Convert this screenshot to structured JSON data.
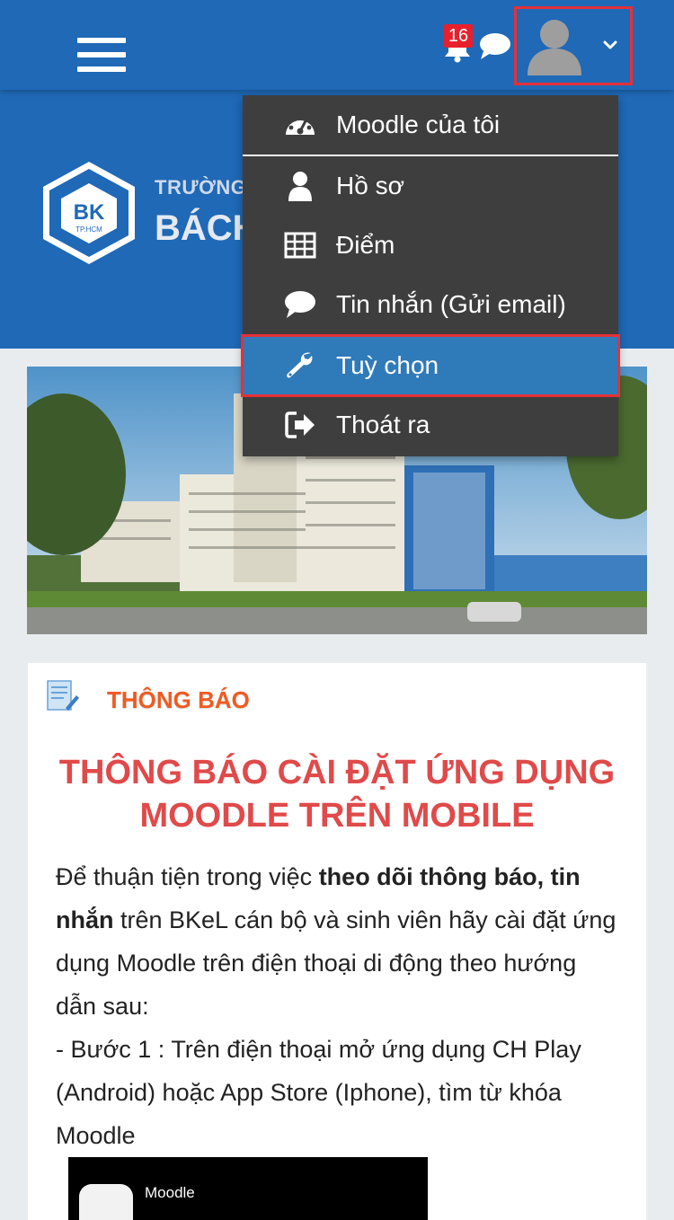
{
  "navbar": {
    "notification_count": "16",
    "icons": {
      "menu": "hamburger-menu-icon",
      "notifications": "bell-icon",
      "messages": "chat-bubble-icon",
      "user": "user-avatar-icon",
      "dropdown": "chevron-down-icon"
    }
  },
  "header": {
    "school_line1": "TRƯỜNG Đ",
    "school_line2": "BÁCH",
    "logo_text": "BK",
    "logo_subtext": "TP.HCM"
  },
  "user_menu": {
    "items": [
      {
        "label": "Moodle của tôi",
        "icon": "dashboard-gauge-icon"
      },
      {
        "label": "Hồ sơ",
        "icon": "user-icon"
      },
      {
        "label": "Điểm",
        "icon": "grid-table-icon"
      },
      {
        "label": "Tin nhắn (Gửi email)",
        "icon": "chat-bubble-icon"
      },
      {
        "label": "Tuỳ chọn",
        "icon": "wrench-icon",
        "active": true
      },
      {
        "label": "Thoát ra",
        "icon": "sign-out-icon"
      }
    ]
  },
  "announcement": {
    "heading": "THÔNG BÁO",
    "title": "THÔNG BÁO CÀI ĐẶT ỨNG DỤNG MOODLE TRÊN MOBILE",
    "body_part1": "Để thuận tiện trong việc ",
    "body_bold": "theo dõi thông báo, tin nhắn",
    "body_part2": " trên BKeL cán bộ và sinh viên hãy cài đặt ứng dụng Moodle trên điện thoại di động theo hướng dẫn sau:",
    "step1": "- Bước 1 : Trên điện thoại mở ứng dụng CH Play (Android) hoặc App Store (Iphone), tìm từ khóa Moodle",
    "video_app_name": "Moodle"
  },
  "colors": {
    "brand_blue": "#1f69b7",
    "menu_bg": "#3e3e3e",
    "menu_active": "#2f7ab8",
    "highlight_red": "#e53137",
    "heading_orange": "#f05a22",
    "title_red": "#e04a4a",
    "badge_red": "#e8202c"
  }
}
